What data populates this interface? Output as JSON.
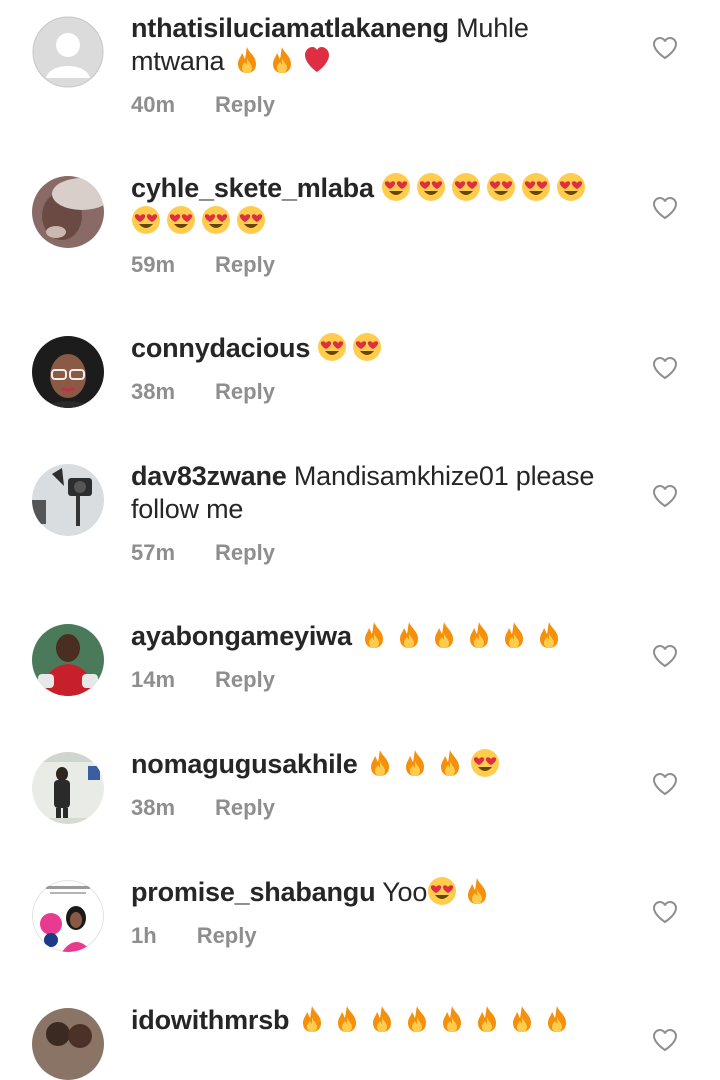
{
  "comments": [
    {
      "username": "nthatisiluciamatlakaneng",
      "text": " Muhle mtwana ",
      "emojis": [
        "fire",
        "fire",
        "red-heart"
      ],
      "time": "40m",
      "reply": "Reply"
    },
    {
      "username": "cyhle_skete_mlaba",
      "text": " ",
      "emojis": [
        "heart-eyes",
        "heart-eyes",
        "heart-eyes",
        "heart-eyes",
        "heart-eyes",
        "heart-eyes",
        "heart-eyes",
        "heart-eyes",
        "heart-eyes",
        "heart-eyes"
      ],
      "time": "59m",
      "reply": "Reply"
    },
    {
      "username": "connydacious",
      "text": " ",
      "emojis": [
        "heart-eyes",
        "heart-eyes"
      ],
      "time": "38m",
      "reply": "Reply"
    },
    {
      "username": "dav83zwane",
      "text": " Mandisamkhize01 please follow me",
      "emojis": [],
      "time": "57m",
      "reply": "Reply"
    },
    {
      "username": "ayabongameyiwa",
      "text": " ",
      "emojis": [
        "fire",
        "fire",
        "fire",
        "fire",
        "fire",
        "fire"
      ],
      "time": "14m",
      "reply": "Reply"
    },
    {
      "username": "nomagugusakhile",
      "text": " ",
      "emojis": [
        "fire",
        "fire",
        "fire",
        "heart-eyes"
      ],
      "time": "38m",
      "reply": "Reply"
    },
    {
      "username": "promise_shabangu",
      "text": " Yoo",
      "emojis": [
        "heart-eyes",
        "fire"
      ],
      "time": "1h",
      "reply": "Reply"
    },
    {
      "username": "idowithmrsb",
      "text": " ",
      "emojis": [
        "fire",
        "fire",
        "fire",
        "fire",
        "fire",
        "fire",
        "fire",
        "fire"
      ],
      "time": "",
      "reply": ""
    }
  ],
  "icons": {
    "like": "heart-outline-icon",
    "fire": "fire-emoji-icon",
    "heart-eyes": "heart-eyes-emoji-icon",
    "red-heart": "red-heart-emoji-icon"
  },
  "colors": {
    "text": "#262626",
    "meta": "#8e8e8e",
    "like_outline": "#8e8e8e"
  }
}
